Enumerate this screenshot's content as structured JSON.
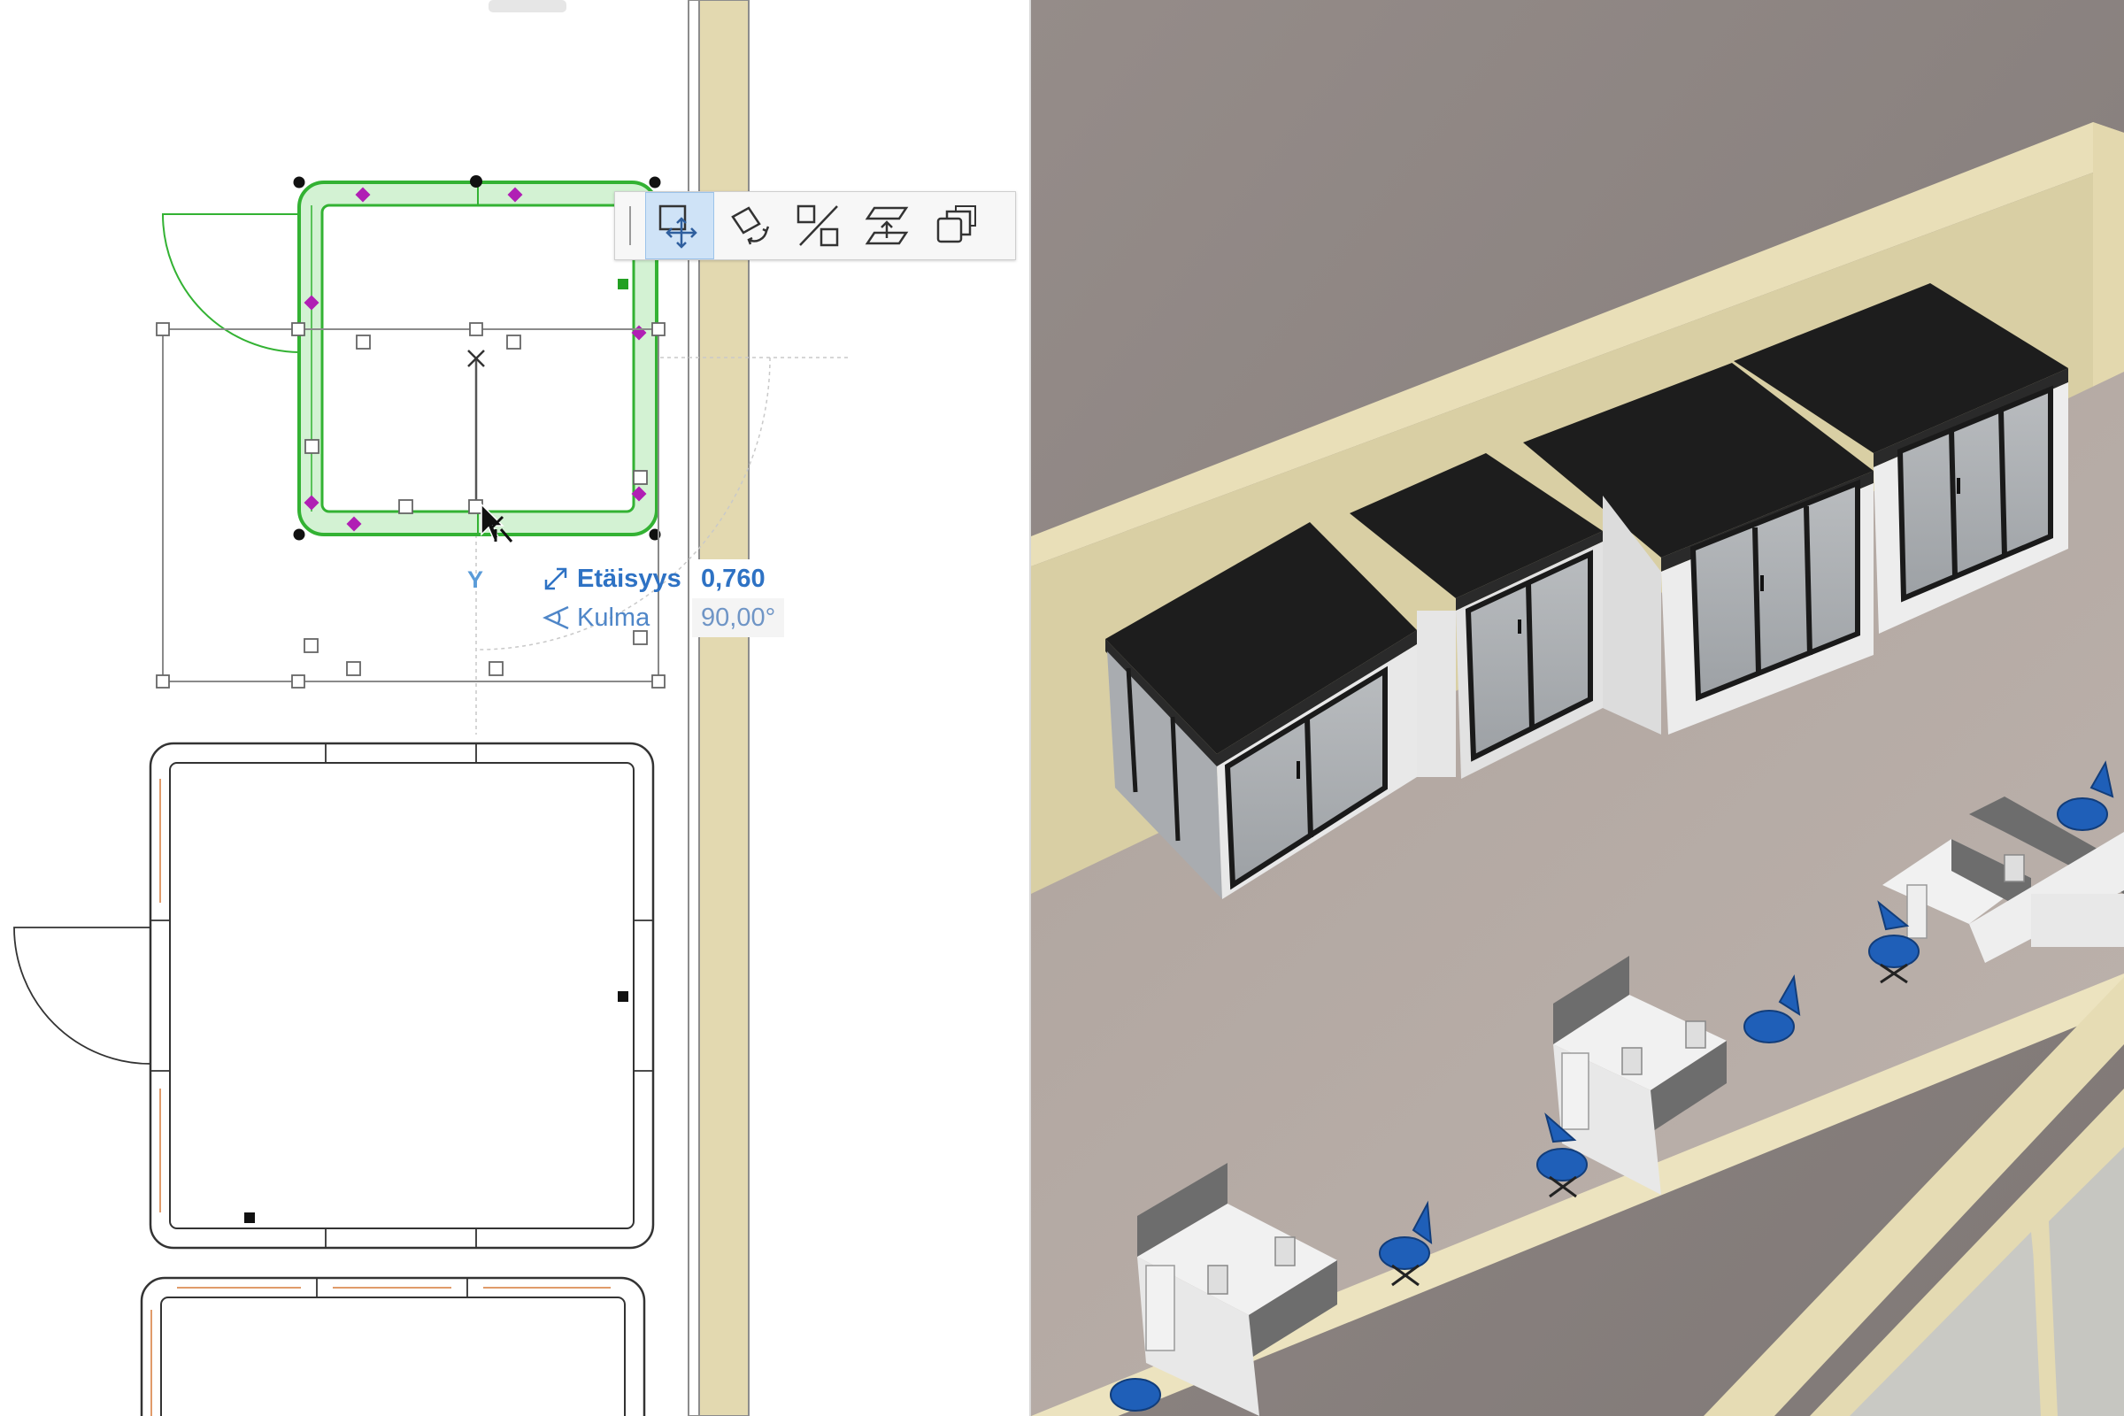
{
  "tracker": {
    "axis_label": "Y",
    "distance_label": "Etäisyys",
    "distance_value": "0,760",
    "angle_label": "Kulma",
    "angle_value": "90,00°"
  },
  "pet_palette": {
    "items": [
      {
        "icon": "drag-move-icon",
        "active": true
      },
      {
        "icon": "rotate-icon",
        "active": false
      },
      {
        "icon": "mirror-icon",
        "active": false
      },
      {
        "icon": "elevate-icon",
        "active": false
      },
      {
        "icon": "multiply-copy-icon",
        "active": false
      }
    ]
  },
  "colors": {
    "selection_green": "#33b233",
    "hotspot_magenta": "#b01fb4",
    "wall_fill": "#e3d9b0",
    "active_tool": "#cfe3f7",
    "tracker_blue": "#2e72c4",
    "pod_roof": "#1d1d1d",
    "floor": "#b4aaa4"
  }
}
